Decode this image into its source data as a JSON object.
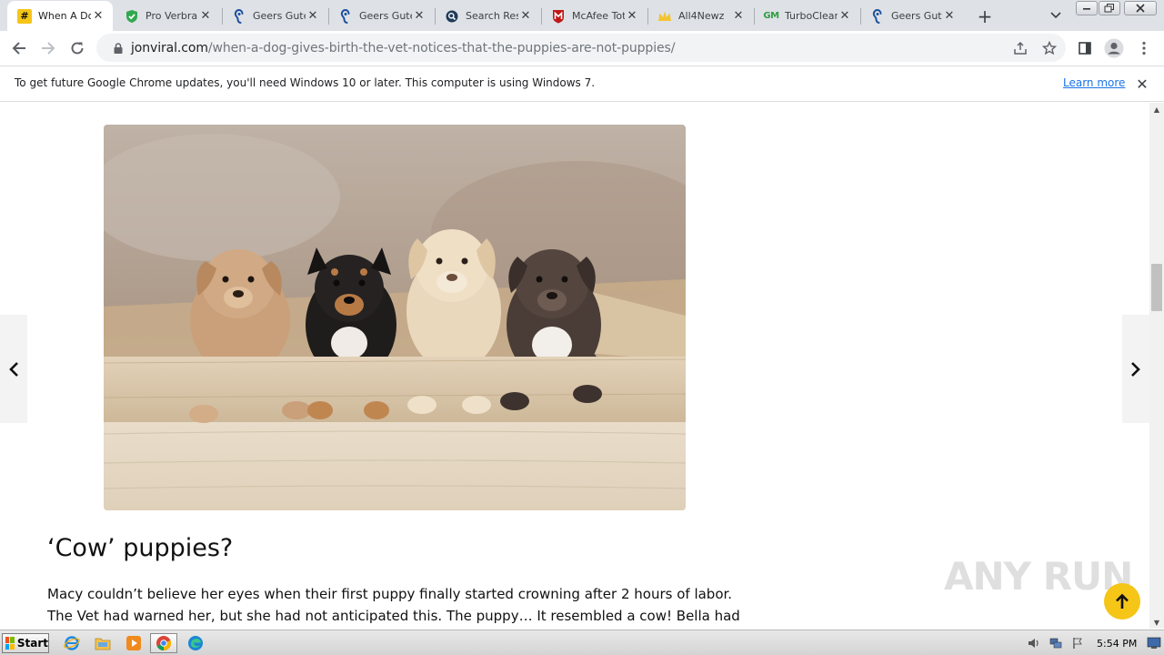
{
  "tabs": [
    {
      "title": "When A Dog Gives Birth",
      "favicon": "#",
      "favicon_bg": "#f5c518",
      "favicon_fg": "#111111"
    },
    {
      "title": "Pro Verbraucher",
      "favicon": "shield-icon"
    },
    {
      "title": "Geers Gutes Hören",
      "favicon": "ear-icon"
    },
    {
      "title": "Geers Gutes Hören",
      "favicon": "ear-icon"
    },
    {
      "title": "Search Results",
      "favicon": "search-icon"
    },
    {
      "title": "McAfee Total Protection",
      "favicon": "mcafee-icon"
    },
    {
      "title": "All4Newz",
      "favicon": "crown-icon"
    },
    {
      "title": "TurboCleaner",
      "favicon": "GM"
    },
    {
      "title": "Geers Gutes Hören",
      "favicon": "ear-icon"
    }
  ],
  "address": {
    "host": "jonviral.com",
    "path": "/when-a-dog-gives-birth-the-vet-notices-that-the-puppies-are-not-puppies/"
  },
  "infobar": {
    "message": "To get future Google Chrome updates, you'll need Windows 10 or later. This computer is using Windows 7.",
    "link": "Learn more"
  },
  "article": {
    "heading": "‘Cow’ puppies?",
    "paragraph": "Macy couldn’t believe her eyes when their first puppy finally started crowning after 2 hours of labor. The Vet had warned her, but she had not anticipated this. The puppy… It resembled a cow! Bella had just",
    "image": "four-puppies-in-wooden-crate"
  },
  "watermark": "ANY RUN",
  "taskbar": {
    "start_label": "Start",
    "clock": "5:54 PM",
    "pinned": [
      "internet-explorer-icon",
      "file-explorer-icon",
      "media-player-icon",
      "chrome-icon",
      "edge-icon"
    ]
  },
  "colors": {
    "accent_yellow": "#f5c518",
    "link_blue": "#1a73e8",
    "tabstrip_bg": "#dee1e6"
  }
}
